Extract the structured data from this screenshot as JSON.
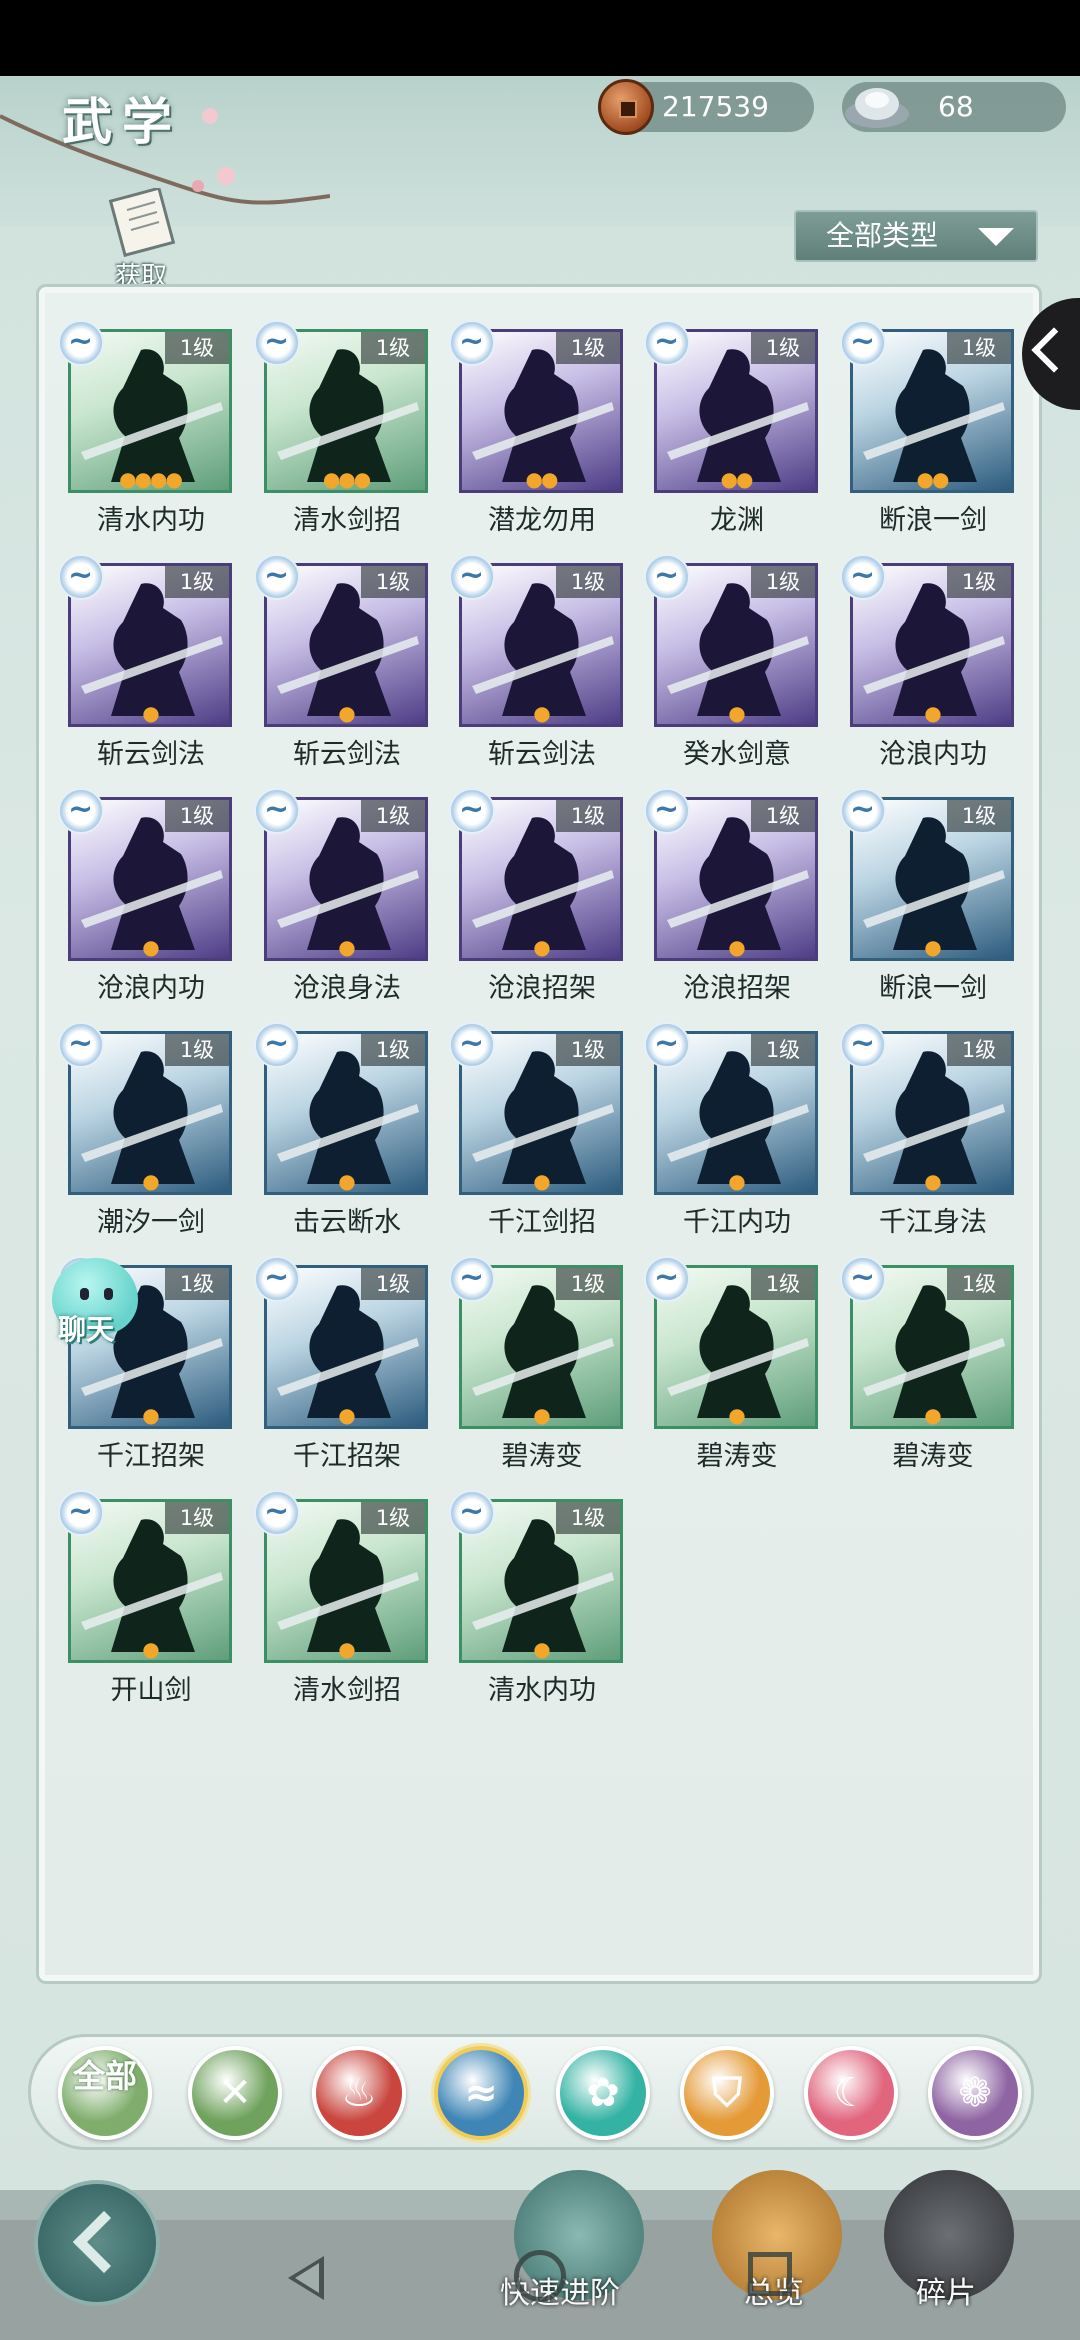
{
  "header": {
    "title": "武学",
    "coins": "217539",
    "silver": "68",
    "acquire_label": "获取",
    "filter_label": "全部类型"
  },
  "skills": [
    {
      "name": "清水内功",
      "level": "1级",
      "rarity": "green",
      "drops": 4
    },
    {
      "name": "清水剑招",
      "level": "1级",
      "rarity": "green",
      "drops": 3
    },
    {
      "name": "潜龙勿用",
      "level": "1级",
      "rarity": "purple",
      "drops": 2
    },
    {
      "name": "龙渊",
      "level": "1级",
      "rarity": "purple",
      "drops": 2
    },
    {
      "name": "断浪一剑",
      "level": "1级",
      "rarity": "blue",
      "drops": 2
    },
    {
      "name": "斩云剑法",
      "level": "1级",
      "rarity": "purple",
      "drops": 1
    },
    {
      "name": "斩云剑法",
      "level": "1级",
      "rarity": "purple",
      "drops": 1
    },
    {
      "name": "斩云剑法",
      "level": "1级",
      "rarity": "purple",
      "drops": 1
    },
    {
      "name": "癸水剑意",
      "level": "1级",
      "rarity": "purple",
      "drops": 1
    },
    {
      "name": "沧浪内功",
      "level": "1级",
      "rarity": "purple",
      "drops": 1
    },
    {
      "name": "沧浪内功",
      "level": "1级",
      "rarity": "purple",
      "drops": 1
    },
    {
      "name": "沧浪身法",
      "level": "1级",
      "rarity": "purple",
      "drops": 1
    },
    {
      "name": "沧浪招架",
      "level": "1级",
      "rarity": "purple",
      "drops": 1
    },
    {
      "name": "沧浪招架",
      "level": "1级",
      "rarity": "purple",
      "drops": 1
    },
    {
      "name": "断浪一剑",
      "level": "1级",
      "rarity": "blue",
      "drops": 1
    },
    {
      "name": "潮汐一剑",
      "level": "1级",
      "rarity": "blue",
      "drops": 1
    },
    {
      "name": "击云断水",
      "level": "1级",
      "rarity": "blue",
      "drops": 1
    },
    {
      "name": "千江剑招",
      "level": "1级",
      "rarity": "blue",
      "drops": 1
    },
    {
      "name": "千江内功",
      "level": "1级",
      "rarity": "blue",
      "drops": 1
    },
    {
      "name": "千江身法",
      "level": "1级",
      "rarity": "blue",
      "drops": 1
    },
    {
      "name": "千江招架",
      "level": "1级",
      "rarity": "blue",
      "drops": 1
    },
    {
      "name": "千江招架",
      "level": "1级",
      "rarity": "blue",
      "drops": 1
    },
    {
      "name": "碧涛变",
      "level": "1级",
      "rarity": "green",
      "drops": 1
    },
    {
      "name": "碧涛变",
      "level": "1级",
      "rarity": "green",
      "drops": 1
    },
    {
      "name": "碧涛变",
      "level": "1级",
      "rarity": "green",
      "drops": 1
    },
    {
      "name": "开山剑",
      "level": "1级",
      "rarity": "green",
      "drops": 1
    },
    {
      "name": "清水剑招",
      "level": "1级",
      "rarity": "green",
      "drops": 1
    },
    {
      "name": "清水内功",
      "level": "1级",
      "rarity": "green",
      "drops": 1
    }
  ],
  "chat": {
    "label": "聊天"
  },
  "categories": [
    {
      "name": "all-category",
      "label": "全部",
      "color": "#7fae6c",
      "glyph": ""
    },
    {
      "name": "blade-category",
      "label": "",
      "color": "#6fa25d",
      "glyph": "✕"
    },
    {
      "name": "flame-category",
      "label": "",
      "color": "#c9453d",
      "glyph": "♨"
    },
    {
      "name": "wave-category",
      "label": "",
      "color": "#3f86b6",
      "glyph": "≈"
    },
    {
      "name": "butterfly-category",
      "label": "",
      "color": "#34b3a4",
      "glyph": "✿"
    },
    {
      "name": "shield-category",
      "label": "",
      "color": "#e49a36",
      "glyph": "⛉"
    },
    {
      "name": "moon-category",
      "label": "",
      "color": "#e0657d",
      "glyph": "☾"
    },
    {
      "name": "rose-category",
      "label": "",
      "color": "#8e64a2",
      "glyph": "❁"
    }
  ],
  "bottom": {
    "fast_label": "快速进阶",
    "overview_label": "总览",
    "fragment_label": "碎片"
  }
}
